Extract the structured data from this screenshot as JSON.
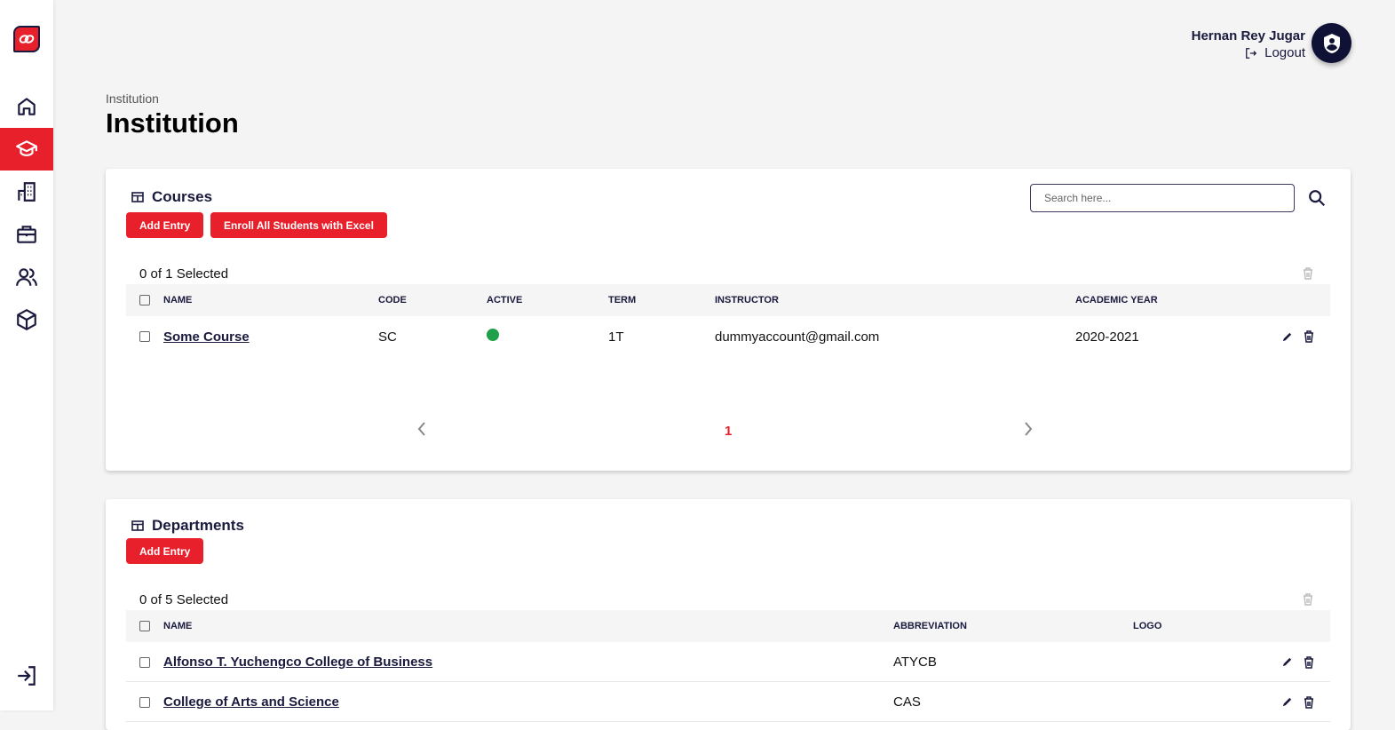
{
  "sidebar": {
    "items": [
      {
        "name": "home",
        "icon": "home-icon"
      },
      {
        "name": "institution",
        "icon": "graduation-cap-icon",
        "active": true
      },
      {
        "name": "buildings",
        "icon": "building-icon"
      },
      {
        "name": "jobs",
        "icon": "briefcase-icon"
      },
      {
        "name": "users",
        "icon": "users-icon"
      },
      {
        "name": "packages",
        "icon": "box-icon"
      }
    ],
    "logout_icon": "logout-icon"
  },
  "header": {
    "user_name": "Hernan Rey Jugar",
    "logout_label": "Logout"
  },
  "page": {
    "breadcrumb": "Institution",
    "title": "Institution"
  },
  "colors": {
    "accent": "#e8202b",
    "navy": "#1a1a3e",
    "active_dot": "#1fa04a"
  },
  "courses": {
    "title": "Courses",
    "add_label": "Add Entry",
    "enroll_label": "Enroll All Students with Excel",
    "search_placeholder": "Search here...",
    "selected": "0 of 1 Selected",
    "columns": [
      "NAME",
      "CODE",
      "ACTIVE",
      "TERM",
      "INSTRUCTOR",
      "ACADEMIC YEAR"
    ],
    "rows": [
      {
        "name": "Some Course",
        "code": "SC",
        "active": true,
        "term": "1T",
        "instructor": "dummyaccount@gmail.com",
        "year": "2020-2021"
      }
    ],
    "pagination": {
      "current": "1"
    }
  },
  "departments": {
    "title": "Departments",
    "add_label": "Add Entry",
    "selected": "0 of 5 Selected",
    "columns": [
      "NAME",
      "ABBREVIATION",
      "LOGO"
    ],
    "rows": [
      {
        "name": "Alfonso T. Yuchengco College of Business",
        "abbr": "ATYCB"
      },
      {
        "name": "College of Arts and Science",
        "abbr": "CAS"
      }
    ]
  }
}
